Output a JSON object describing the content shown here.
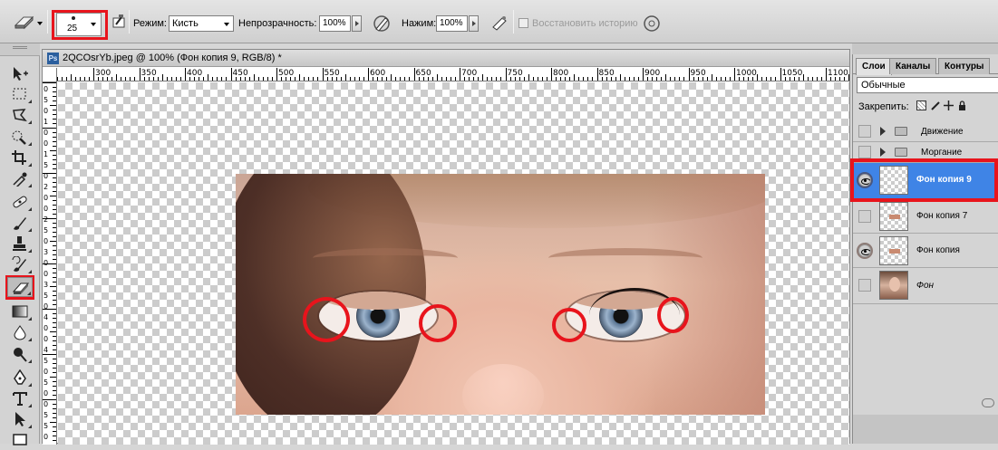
{
  "options_bar": {
    "brush_size": "25",
    "mode_label": "Режим:",
    "mode_value": "Кисть",
    "opacity_label": "Непрозрачность:",
    "opacity_value": "100%",
    "flow_label": "Нажим:",
    "flow_value": "100%",
    "restore_history_label": "Восстановить историю",
    "restore_history_checked": false
  },
  "document": {
    "tab_title": "2QCOsrYb.jpeg @ 100% (Фон копия 9, RGB/8) *",
    "ps_badge": "Ps",
    "ruler_h_labels": [
      "300",
      "350",
      "400",
      "450",
      "500",
      "550",
      "600",
      "650",
      "700",
      "750",
      "800",
      "850",
      "900",
      "950",
      "1000",
      "1050",
      "1100"
    ],
    "ruler_v_labels": [
      "0",
      "5",
      "0",
      "1",
      "0",
      "0",
      "1",
      "5",
      "0",
      "2",
      "0",
      "0",
      "2",
      "5",
      "0",
      "3",
      "0",
      "0",
      "3",
      "5",
      "0",
      "4",
      "0",
      "0",
      "4",
      "5",
      "0",
      "5",
      "0",
      "0",
      "5",
      "5",
      "0"
    ],
    "marker_color": "#e8141c"
  },
  "tools": [
    "move-tool",
    "marquee-tool",
    "lasso-tool",
    "quick-selection-tool",
    "crop-tool",
    "eyedropper-tool",
    "healing-brush-tool",
    "brush-tool",
    "clone-stamp-tool",
    "history-brush-tool",
    "eraser-tool",
    "gradient-tool",
    "blur-tool",
    "dodge-tool",
    "pen-tool",
    "type-tool",
    "path-selection-tool",
    "rectangle-tool"
  ],
  "layers_panel": {
    "tabs": [
      "Слои",
      "Каналы",
      "Контуры"
    ],
    "active_tab": "Слои",
    "blend_mode": "Обычные",
    "lock_label": "Закрепить:",
    "layers": [
      {
        "name": "Движение",
        "type": "group",
        "visible": false
      },
      {
        "name": "Моргание",
        "type": "group",
        "visible": false
      },
      {
        "name": "Фон копия 9",
        "type": "layer",
        "visible": true,
        "selected": true
      },
      {
        "name": "Фон копия 7",
        "type": "layer",
        "visible": false
      },
      {
        "name": "Фон копия",
        "type": "layer",
        "visible": true
      },
      {
        "name": "Фон",
        "type": "background",
        "visible": false
      }
    ],
    "selection_color": "#3f84e6"
  }
}
